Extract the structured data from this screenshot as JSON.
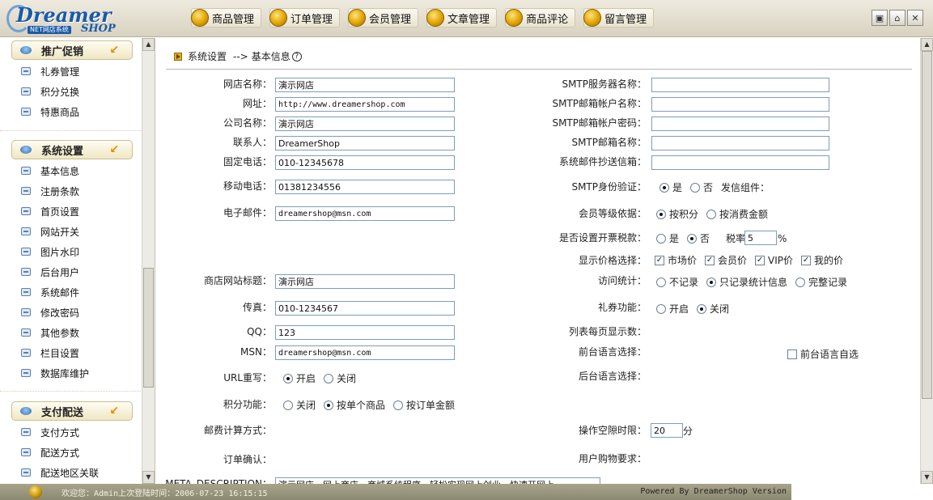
{
  "logo": {
    "main": "Dreamer",
    "tag": "NET网店系统",
    "sub": "SHOP"
  },
  "nav": [
    "商品管理",
    "订单管理",
    "会员管理",
    "文章管理",
    "商品评论",
    "留言管理"
  ],
  "window_buttons": {
    "restore": "▣",
    "home": "⌂",
    "close": "✕"
  },
  "sidebar": {
    "groups": [
      {
        "title": "推广促销",
        "items": [
          "礼券管理",
          "积分兑换",
          "特惠商品"
        ]
      },
      {
        "title": "系统设置",
        "items": [
          "基本信息",
          "注册条款",
          "首页设置",
          "网站开关",
          "图片水印",
          "后台用户",
          "系统邮件",
          "修改密码",
          "其他参数",
          "栏目设置",
          "数据库维护"
        ]
      },
      {
        "title": "支付配送",
        "items": [
          "支付方式",
          "配送方式",
          "配送地区关联"
        ]
      }
    ]
  },
  "breadcrumb": {
    "section": "系统设置",
    "arrow": "-->",
    "page": "基本信息",
    "help": "?"
  },
  "form_left": {
    "shop_name": {
      "label": "网店名称：",
      "value": "演示网店"
    },
    "url": {
      "label": "网址：",
      "value": "http://www.dreamershop.com"
    },
    "company": {
      "label": "公司名称：",
      "value": "演示网店"
    },
    "contact": {
      "label": "联系人：",
      "value": "DreamerShop"
    },
    "phone": {
      "label": "固定电话：",
      "value": "010-12345678"
    },
    "mobile": {
      "label": "移动电话：",
      "value": "01381234556"
    },
    "email": {
      "label": "电子邮件：",
      "value": "dreamershop@msn.com"
    },
    "site_title": {
      "label": "商店网站标题：",
      "value": "演示网店"
    },
    "fax": {
      "label": "传真：",
      "value": "010-1234567"
    },
    "qq": {
      "label": "QQ：",
      "value": "123"
    },
    "msn": {
      "label": "MSN：",
      "value": "dreamershop@msn.com"
    },
    "url_rewrite": {
      "label": "URL重写：",
      "options": [
        "开启",
        "关闭"
      ]
    },
    "points": {
      "label": "积分功能：",
      "options": [
        "关闭",
        "按单个商品",
        "按订单金额"
      ]
    },
    "postage": {
      "label": "邮费计算方式："
    },
    "order_confirm": {
      "label": "订单确认："
    },
    "meta_desc": {
      "label": "META_DESCRIPTION：",
      "value": "演示网店，网上商店，商城系统程序，轻松实现网上创业，快速开网上"
    }
  },
  "form_right": {
    "smtp_server": {
      "label": "SMTP服务器名称：",
      "value": ""
    },
    "smtp_account": {
      "label": "SMTP邮箱帐户名称：",
      "value": ""
    },
    "smtp_password": {
      "label": "SMTP邮箱帐户密码：",
      "value": ""
    },
    "smtp_mailbox": {
      "label": "SMTP邮箱名称：",
      "value": ""
    },
    "cc_mailbox": {
      "label": "系统邮件抄送信箱：",
      "value": ""
    },
    "smtp_auth": {
      "label": "SMTP身份验证：",
      "options": [
        "是",
        "否"
      ],
      "extra": "发信组件："
    },
    "member_level": {
      "label": "会员等级依据：",
      "options": [
        "按积分",
        "按消费金额"
      ]
    },
    "invoice_tax": {
      "label": "是否设置开票税款：",
      "options": [
        "是",
        "否"
      ],
      "rate_label": "税率",
      "rate_value": "5",
      "unit": "%"
    },
    "price_display": {
      "label": "显示价格选择：",
      "options": [
        "市场价",
        "会员价",
        "VIP价",
        "我的价"
      ]
    },
    "visit_stats": {
      "label": "访问统计：",
      "options": [
        "不记录",
        "只记录统计信息",
        "完整记录"
      ]
    },
    "coupon": {
      "label": "礼券功能：",
      "options": [
        "开启",
        "关闭"
      ]
    },
    "list_per_page": {
      "label": "列表每页显示数："
    },
    "front_lang": {
      "label": "前台语言选择：",
      "auto_label": "前台语言自选"
    },
    "back_lang": {
      "label": "后台语言选择："
    },
    "idle_timeout": {
      "label": "操作空隙时限：",
      "value": "20",
      "unit": "分"
    },
    "user_shopping": {
      "label": "用户购物要求："
    }
  },
  "status": {
    "welcome": "欢迎您：Admin上次登陆时间：2006-07-23 16:15:15",
    "powered": "Powered By DreamerShop Version"
  }
}
